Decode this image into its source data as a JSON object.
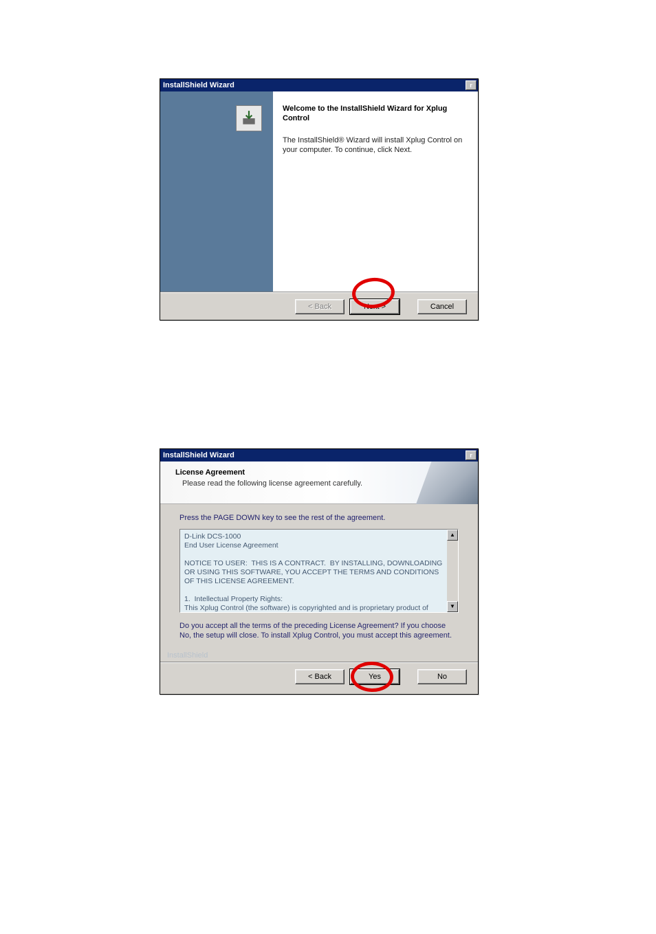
{
  "window1": {
    "title": "InstallShield Wizard",
    "heading": "Welcome to the InstallShield Wizard for Xplug Control",
    "body_text": "The InstallShield® Wizard will install Xplug Control on your computer.  To continue, click Next.",
    "buttons": {
      "back": "< Back",
      "next": "Next >",
      "cancel": "Cancel"
    }
  },
  "window2": {
    "title": "InstallShield Wizard",
    "heading": "License Agreement",
    "subheading": "Please read the following license agreement carefully.",
    "instruction": "Press the PAGE DOWN key to see the rest of the agreement.",
    "agreement_text": "D-Link DCS-1000\nEnd User License Agreement\n\nNOTICE TO USER:  THIS IS A CONTRACT.  BY INSTALLING, DOWNLOADING OR USING THIS SOFTWARE, YOU ACCEPT THE TERMS AND CONDITIONS OF THIS LICENSE AGREEMENT.\n\n1.  Intellectual Property Rights:\nThis Xplug Control (the software) is copyrighted and is proprietary product of Cellvision Systems, Inc.  The software is also protected by United States Copyright Law and",
    "question": "Do you accept all the terms of the preceding License Agreement? If you choose No, the setup will close.  To install Xplug Control, you must accept this agreement.",
    "brand": "InstallShield",
    "buttons": {
      "back": "< Back",
      "yes": "Yes",
      "no": "No"
    }
  }
}
